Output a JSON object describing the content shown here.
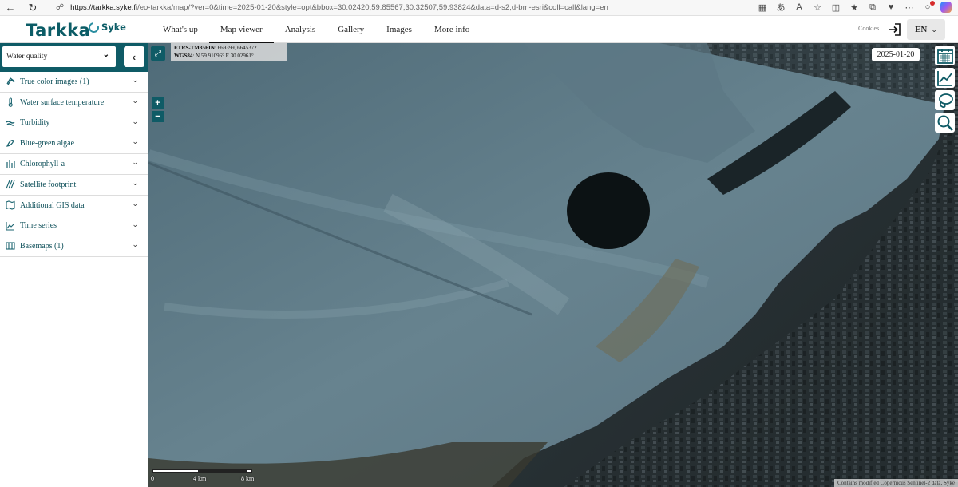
{
  "browser": {
    "url_host": "https://tarkka.syke.fi",
    "url_path": "/eo-tarkka/map/?ver=0&time=2025-01-20&style=opt&bbox=30.02420,59.85567,30.32507,59.93824&data=d-s2,d-bm-esri&coll=call&lang=en"
  },
  "header": {
    "logo": "Tarkka",
    "org": "Syke",
    "nav": [
      "What's up",
      "Map viewer",
      "Analysis",
      "Gallery",
      "Images",
      "More info"
    ],
    "active_tab": "Map viewer",
    "cookies": "Cookies",
    "language": "EN"
  },
  "sidebar": {
    "selected_layer": "Water quality",
    "items": [
      {
        "label": "True color images (1)",
        "icon": "image-stack-icon"
      },
      {
        "label": "Water surface temperature",
        "icon": "thermometer-icon"
      },
      {
        "label": "Turbidity",
        "icon": "turbidity-icon"
      },
      {
        "label": "Blue-green algae",
        "icon": "algae-icon"
      },
      {
        "label": "Chlorophyll-a",
        "icon": "chlorophyll-icon"
      },
      {
        "label": "Satellite footprint",
        "icon": "footprint-icon"
      },
      {
        "label": "Additional GIS data",
        "icon": "map-layers-icon"
      },
      {
        "label": "Time series",
        "icon": "line-chart-icon"
      },
      {
        "label": "Basemaps (1)",
        "icon": "basemap-icon"
      }
    ]
  },
  "map": {
    "coords_label_1": "ETRS-TM35FIN",
    "coords_value_1": ": 669399, 6645372",
    "coords_label_2": "WGS84",
    "coords_value_2": ": N 59.91096° E 30.02961°",
    "zoom_in": "+",
    "zoom_out": "−",
    "date": "2025-01-20",
    "scale_labels": [
      "0",
      "4 km",
      "8 km"
    ],
    "attribution": "Contains modified Copernicus Sentinel-2 data, Syke"
  },
  "colors": {
    "brand": "#0f5b66",
    "logo": "#0b5c66",
    "menu_text": "#0d4f59"
  }
}
